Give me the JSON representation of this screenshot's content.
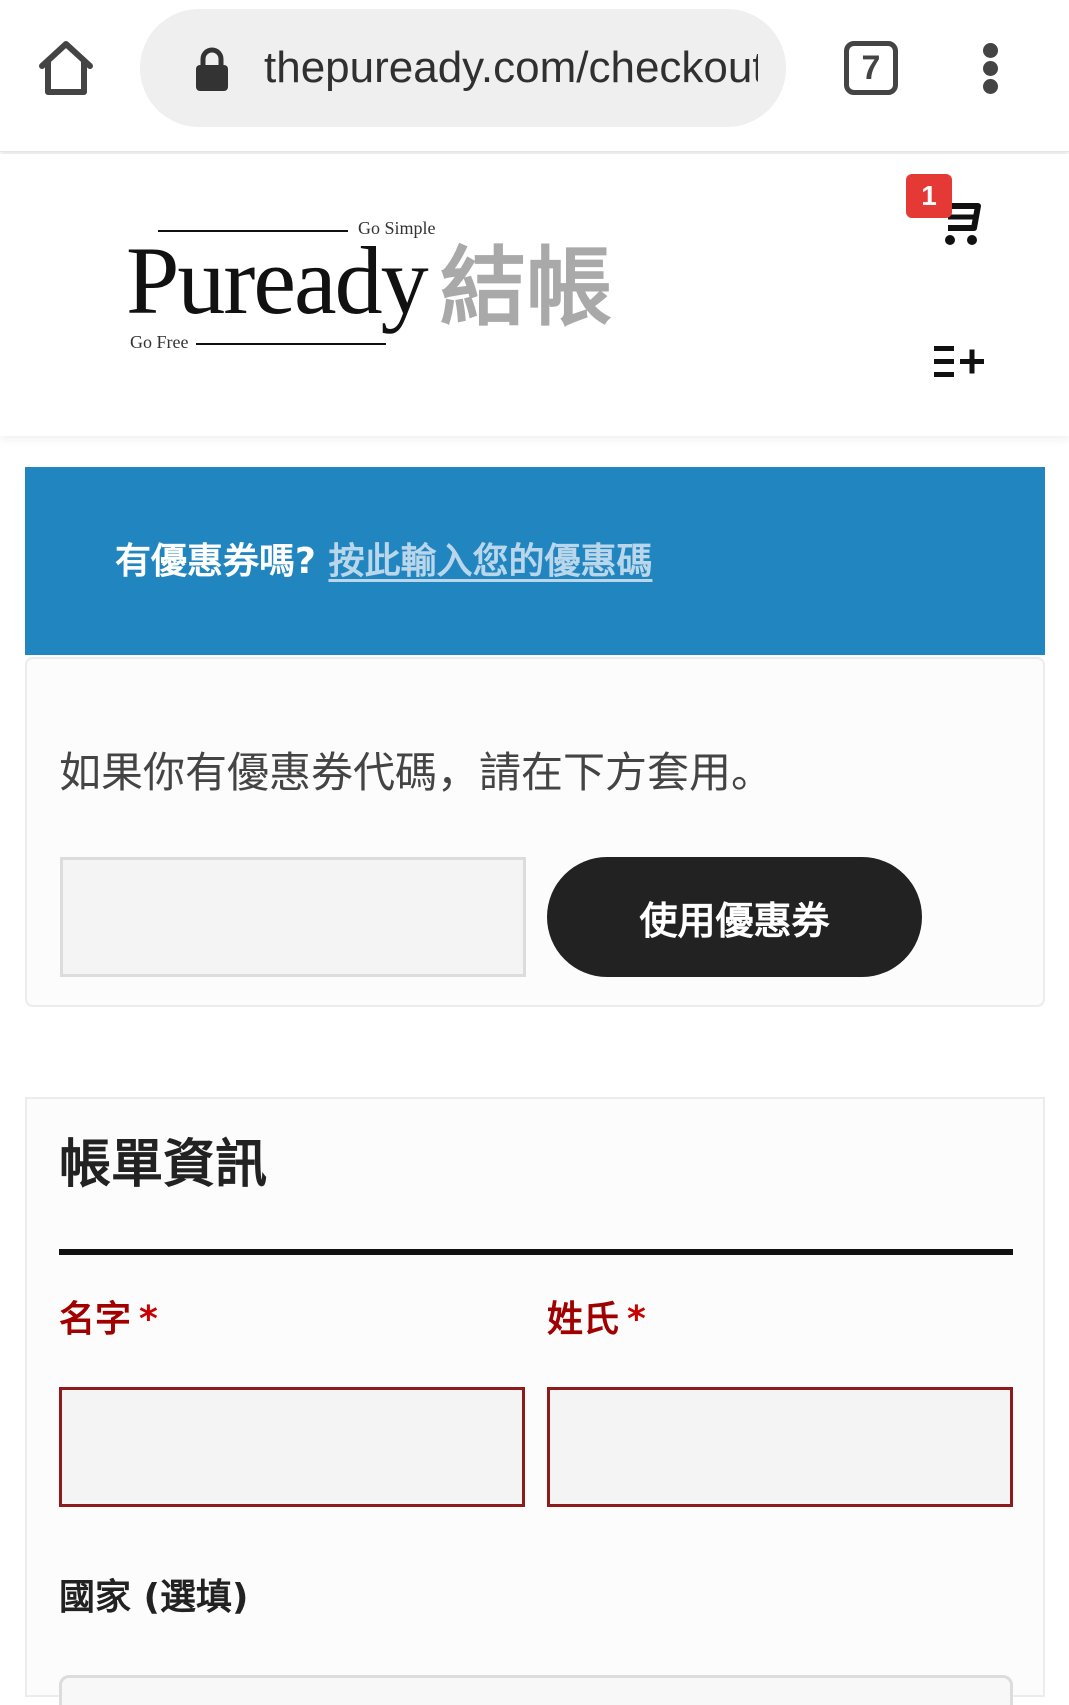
{
  "browser": {
    "url": "thepuready.com/checkout/",
    "tab_count": "7"
  },
  "header": {
    "logo": {
      "tagline_top": "Go Simple",
      "wordmark": "Puready",
      "tagline_bottom": "Go Free"
    },
    "page_title": "結帳",
    "cart_count": "1"
  },
  "coupon_notice": {
    "question": "有優惠券嗎?",
    "link_text": "按此輸入您的優惠碼"
  },
  "coupon_form": {
    "description": "如果你有優惠券代碼，請在下方套用。",
    "input_value": "",
    "apply_label": "使用優惠券"
  },
  "billing": {
    "title": "帳單資訊",
    "first_name_label": "名字",
    "last_name_label": "姓氏",
    "required_mark": "*",
    "first_name_value": "",
    "last_name_value": "",
    "country_label": "國家 (選填)"
  },
  "colors": {
    "notice_bg": "#2186c0",
    "button_bg": "#222222",
    "required_red": "#a00000",
    "badge_red": "#e53935"
  },
  "icons": [
    "home-icon",
    "lock-icon",
    "tab-switcher-icon",
    "more-vert-icon",
    "cart-icon",
    "menu-plus-icon"
  ]
}
